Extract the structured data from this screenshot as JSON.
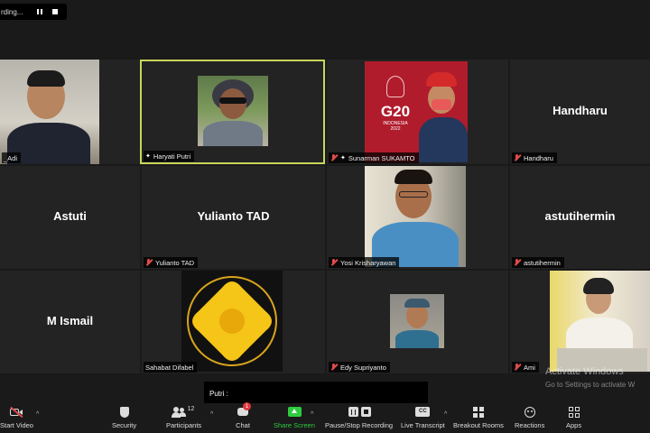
{
  "recording": {
    "status_text": "rding..."
  },
  "participants": [
    {
      "name": "_Adi"
    },
    {
      "name": "Haryati Putri",
      "pinned": true,
      "active_speaker": true
    },
    {
      "name": "Sunarman SUKAMTO",
      "muted": true,
      "pinned": true
    },
    {
      "name": "Handharu",
      "display": "Handharu",
      "muted": true
    },
    {
      "name": "Astuti",
      "display": "Astuti"
    },
    {
      "name": "Yulianto TAD",
      "display": "Yulianto TAD",
      "muted": true
    },
    {
      "name": "Yosi Krisharyawan",
      "muted": true
    },
    {
      "name": "astutihermin",
      "display": "astutihermin",
      "muted": true
    },
    {
      "name": "M Ismail",
      "display": "M Ismail"
    },
    {
      "name": "Sahabat Difabel"
    },
    {
      "name": "Edy Supriyanto",
      "muted": true
    },
    {
      "name": "Ami",
      "muted": true
    }
  ],
  "g20": {
    "line1": "G20",
    "line2": "INDONESIA",
    "line3": "2022"
  },
  "chat": {
    "recipient_label": "Putri :"
  },
  "watermark": {
    "title": "Activate Windows",
    "subtitle": "Go to Settings to activate W"
  },
  "toolbar": {
    "start_video": "Start Video",
    "security": "Security",
    "participants": "Participants",
    "participants_count": "12",
    "chat": "Chat",
    "chat_badge": "1",
    "share_screen": "Share Screen",
    "pause_stop_recording": "Pause/Stop Recording",
    "cc_icon_text": "CC",
    "live_transcript": "Live Transcript",
    "breakout_rooms": "Breakout Rooms",
    "reactions": "Reactions",
    "apps": "Apps"
  },
  "colors": {
    "active_border": "#c7d65a",
    "share_green": "#2ecc40",
    "muted_red": "#e04b4b",
    "badge_red": "#e0383e"
  }
}
